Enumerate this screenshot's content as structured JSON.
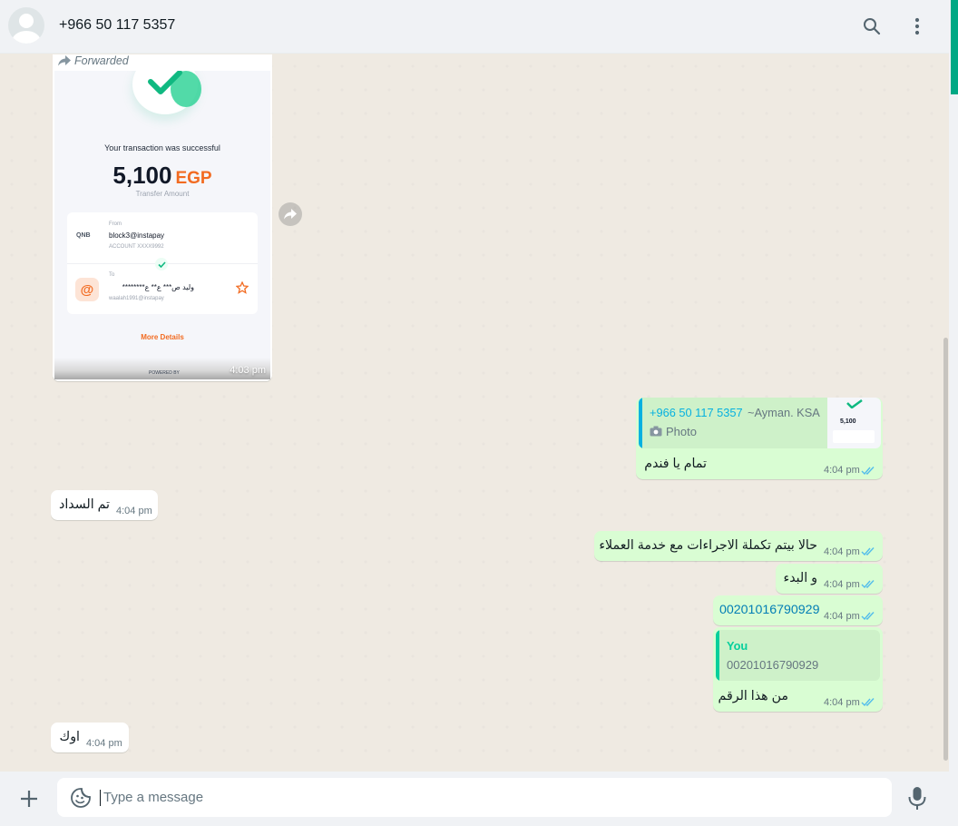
{
  "header": {
    "contact_name": "+966 50 117 5357"
  },
  "icons": {
    "search": "search-icon",
    "menu": "kebab-menu-icon",
    "forward": "forward-arrow-icon",
    "plus": "plus-icon",
    "emoji": "sticker-emoji-icon",
    "mic": "microphone-icon",
    "ticks": "double-check-icon",
    "camera": "camera-icon"
  },
  "colors": {
    "outgoing_bubble": "#d9fdd3",
    "incoming_bubble": "#ffffff",
    "read_ticks": "#53bdeb",
    "accent": "#00a884",
    "quote_author_blue": "#06b1e0",
    "quote_author_green": "#06cf9c",
    "brand_orange": "#f26b21"
  },
  "image_message": {
    "forwarded_label": "Forwarded",
    "time": "4:03 pm",
    "receipt": {
      "success_text": "Your transaction was successful",
      "amount": "5,100",
      "currency": "EGP",
      "amount_label": "Transfer Amount",
      "from_label": "From",
      "bank": "QNB",
      "from_account": "block3@instapay",
      "from_account_no": "ACCOUNT XXXX9992",
      "to_label": "To",
      "to_name": "وليد ص*** ع** ع********",
      "to_handle": "waalah1991@instapay",
      "more_details": "More Details",
      "powered_by": "POWERED BY"
    }
  },
  "messages": [
    {
      "id": "m1",
      "direction": "out",
      "quote": {
        "author": "+966 50 117 5357",
        "author_alias": "~Ayman. KSA",
        "type_label": "Photo",
        "thumb_amount": "5,100"
      },
      "text": "تمام يا فندم",
      "time": "4:04 pm"
    },
    {
      "id": "m2",
      "direction": "in",
      "text": "تم السداد",
      "time": "4:04 pm"
    },
    {
      "id": "m3",
      "direction": "out",
      "text": "حالا بيتم تكملة الاجراءات مع خدمة العملاء",
      "time": "4:04 pm"
    },
    {
      "id": "m4",
      "direction": "out",
      "text": "و البدء",
      "time": "4:04 pm"
    },
    {
      "id": "m5",
      "direction": "out",
      "text": "00201016790929",
      "time": "4:04 pm"
    },
    {
      "id": "m6",
      "direction": "out",
      "quote": {
        "author": "You",
        "text": "00201016790929"
      },
      "text": "من هذا الرقم",
      "time": "4:04 pm"
    },
    {
      "id": "m7",
      "direction": "in",
      "text": "اوك",
      "time": "4:04 pm"
    }
  ],
  "composer": {
    "placeholder": "Type a message",
    "value": ""
  }
}
